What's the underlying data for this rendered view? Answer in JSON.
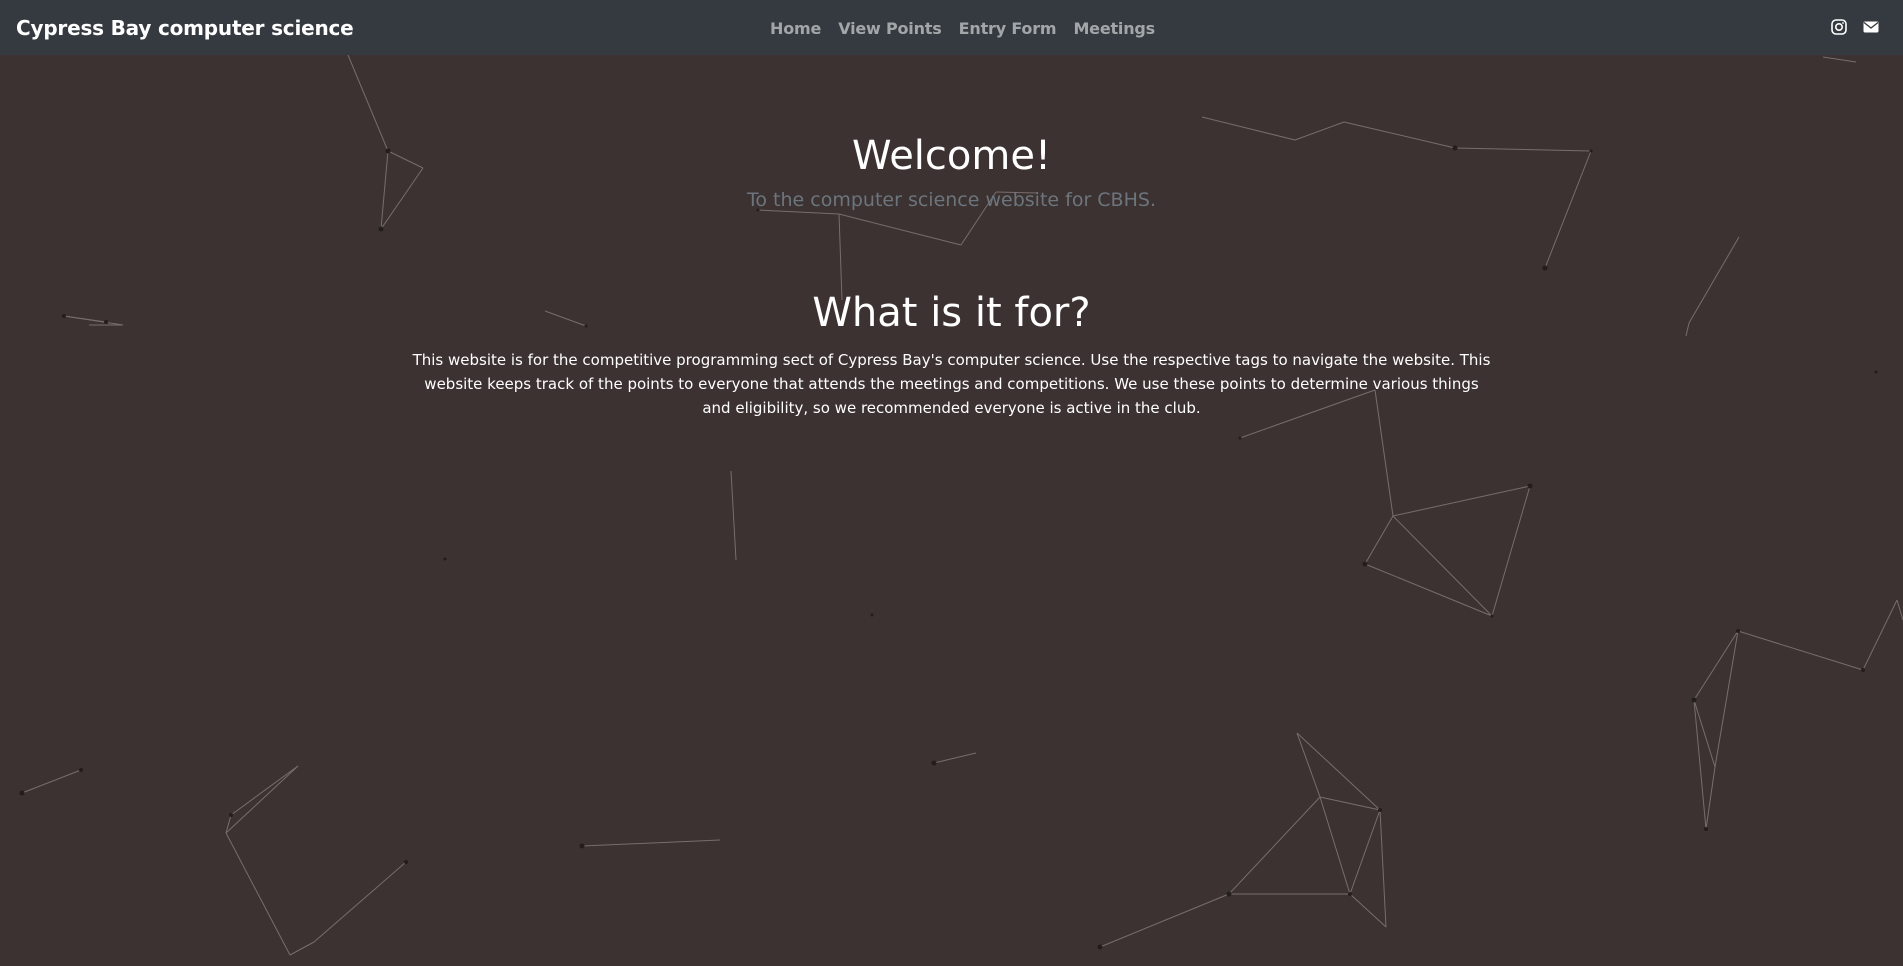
{
  "header": {
    "brand": "Cypress Bay computer science",
    "nav": [
      "Home",
      "View Points",
      "Entry Form",
      "Meetings"
    ],
    "icons": [
      "instagram-icon",
      "envelope-icon"
    ]
  },
  "main": {
    "welcome_title": "Welcome!",
    "welcome_subtitle": "To the computer science website for CBHS.",
    "about_title": "What is it for?",
    "about_text": "This website is for the competitive programming sect of Cypress Bay's computer science. Use the respective tags to navigate the website. This website keeps track of the points to everyone that attends the meetings and competitions. We use these points to determine various things and eligibility, so we recommended everyone is active in the club."
  },
  "colors": {
    "navbar": "#343a40",
    "background": "#3c3231",
    "particles": "#8a8282"
  }
}
